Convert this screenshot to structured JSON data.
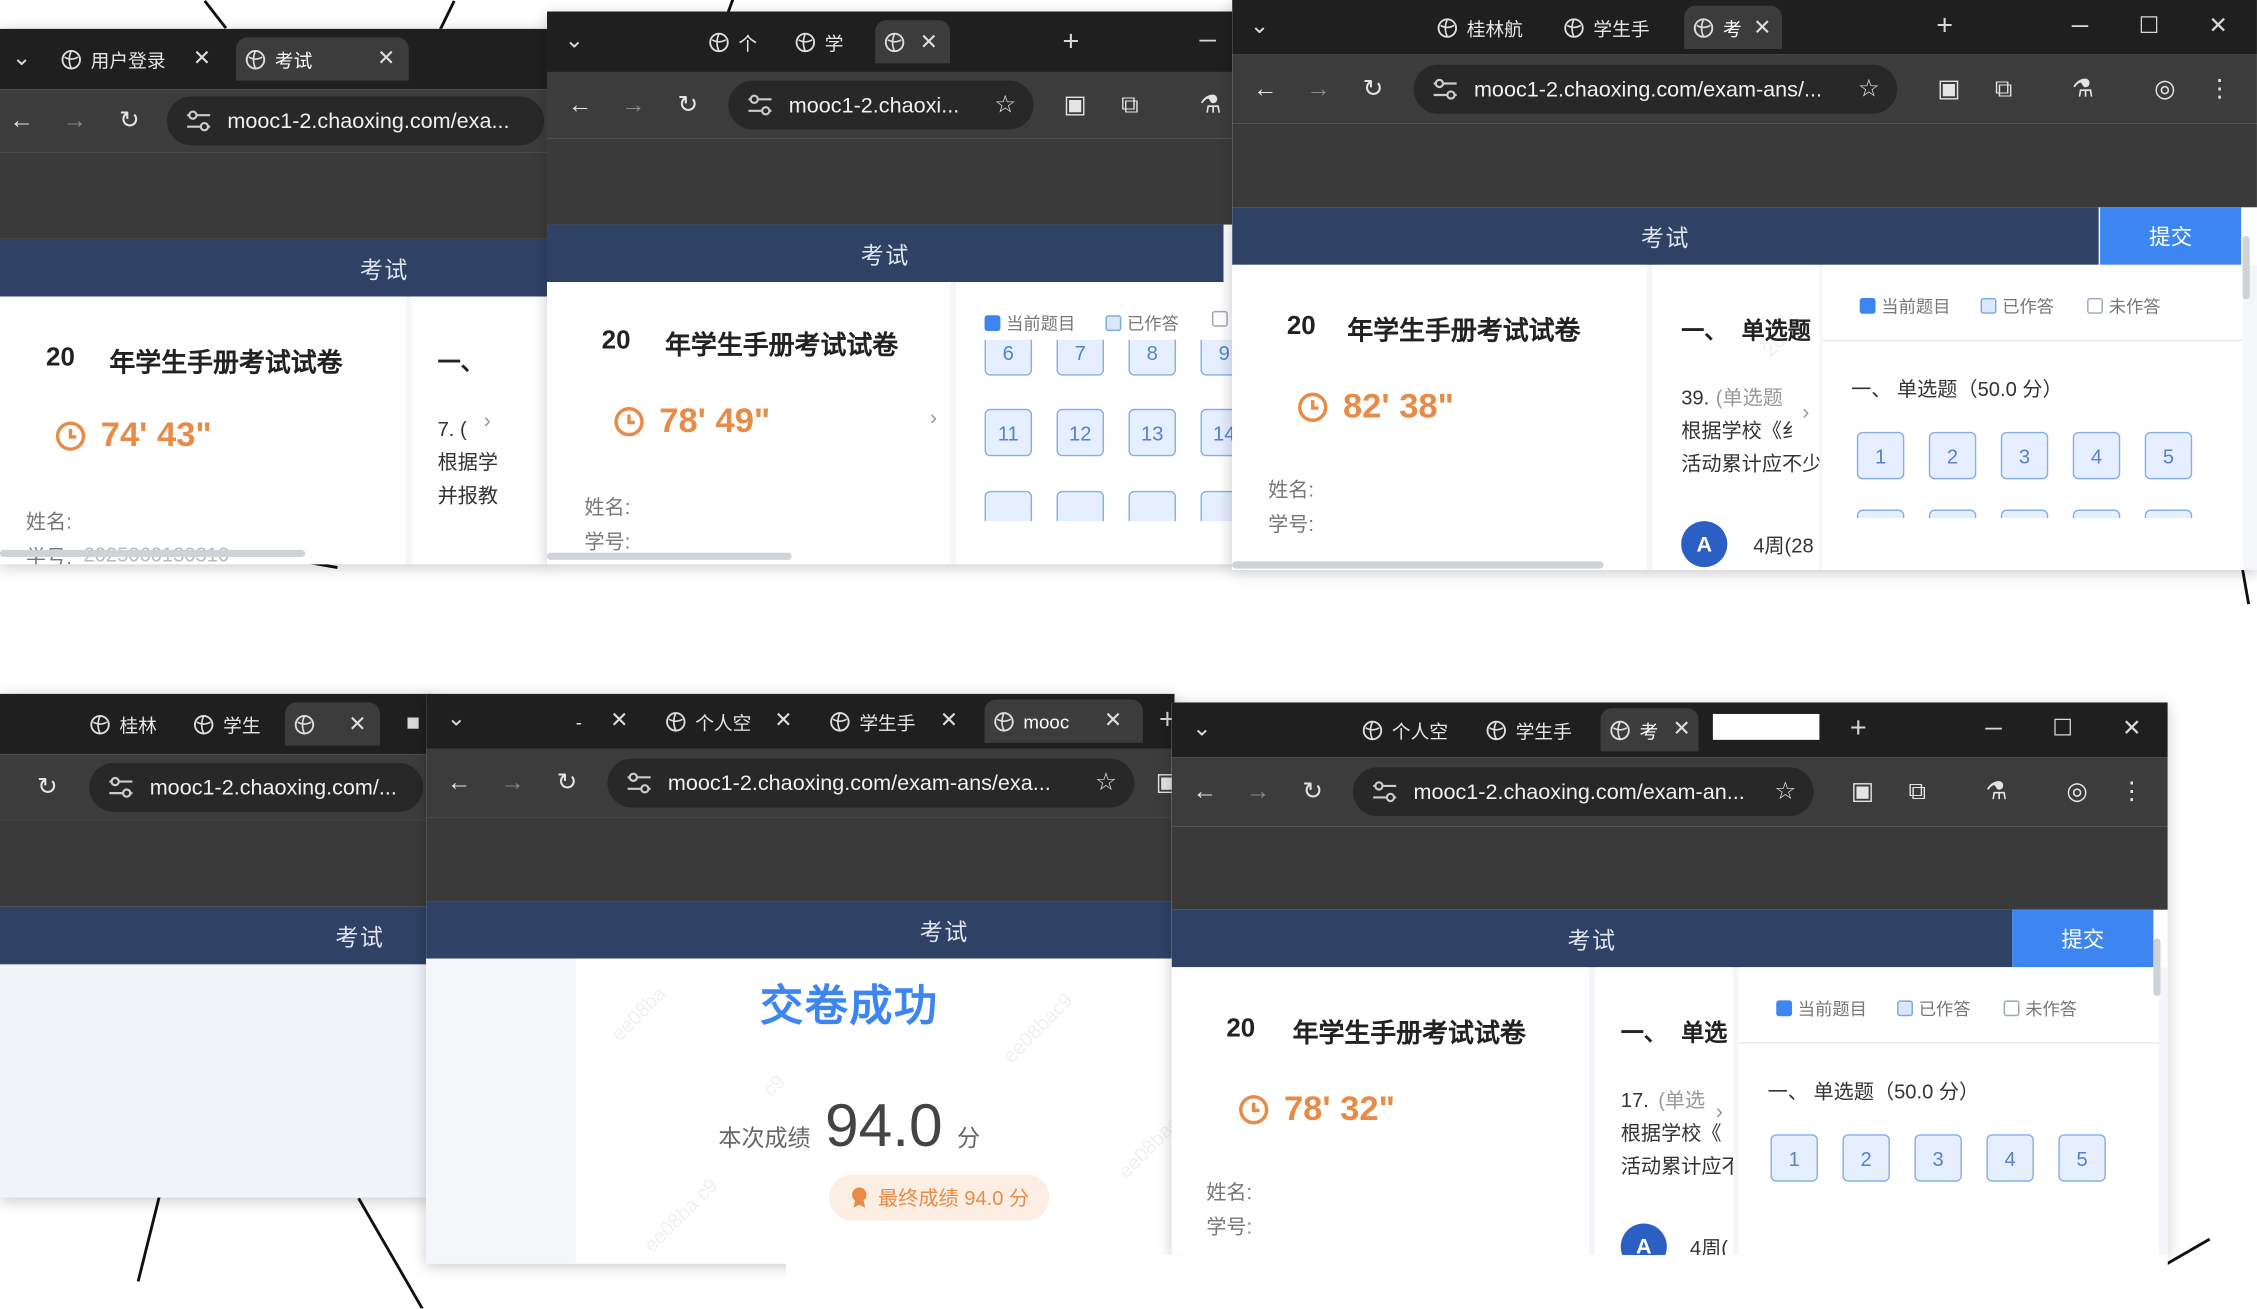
{
  "page_header": "考试",
  "exam_title": "年学生手册考试试卷",
  "exam_year_prefix": "20",
  "exam_year_partial": "20",
  "name_label": "姓名:",
  "student_id_label": "学号:",
  "url_truncated_1": "mooc1-2.chaoxing.com/exa...",
  "url_truncated_2": "mooc1-2.chaoxi...",
  "url_truncated_3": "mooc1-2.chaoxing.com/exam-ans/...",
  "url_truncated_4": "mooc1-2.chaoxing.com/...",
  "url_truncated_5": "mooc1-2.chaoxing.com/exam-ans/exa...",
  "url_truncated_6": "mooc1-2.chaoxing.com/exam-an...",
  "submit_label": "提交",
  "legend": {
    "current": "当前题目",
    "answered": "已作答",
    "unanswered": "未作答"
  },
  "section_label": "一、",
  "section_single": "单选题",
  "section_single_trunc": "单选",
  "section_with_score": "一、 单选题（50.0 分）",
  "tabs": {
    "w1": [
      "用户登录",
      "考试"
    ],
    "w2": [
      "个",
      "学"
    ],
    "w3": [
      "桂林航",
      "学生手",
      "考"
    ],
    "w4": [
      "桂林",
      "学生"
    ],
    "w5": [
      "-",
      "个人空",
      "学生手",
      "mooc"
    ],
    "w6": [
      "个人空",
      "学生手",
      "考"
    ]
  },
  "timers": {
    "w1": "74' 43\"",
    "w2": "78' 49\"",
    "w3": "82' 38\"",
    "w6": "78' 32\""
  },
  "grid_numbers": [
    "1",
    "2",
    "3",
    "4",
    "5"
  ],
  "grid_numbers_w2_top": [
    "6",
    "7",
    "8",
    "9"
  ],
  "grid_numbers_w2_mid": [
    "11",
    "12",
    "13",
    "14"
  ],
  "question_w1": {
    "number": "7. (",
    "line1": "根据学",
    "line2": "并报教"
  },
  "question_w3": {
    "number": "39.",
    "type": "(单选题",
    "line1": "根据学校《纟",
    "line2": "活动累计应不少"
  },
  "question_w6": {
    "number": "17.",
    "type": "(单选",
    "line1": "根据学校《",
    "line2": "活动累计应不"
  },
  "avatar_letter": "A",
  "avatar_text_w3": "4周(28",
  "avatar_text_w6": "4周(",
  "student_id_partial": "2025060130310",
  "success": {
    "title": "交卷成功",
    "score_label": "本次成绩",
    "score": "94.0",
    "unit": "分",
    "final": "最终成绩 94.0 分"
  },
  "watermarks": [
    "2025",
    "ee08ba",
    "c9",
    "ee08ba c9",
    "ee08bac9",
    "ee08bac3"
  ],
  "colors": {
    "header": "#2f4266",
    "accent": "#3d86f2",
    "timer": "#e88b47",
    "tabbar": "#1f1f1f",
    "toolbar": "#3c3c3c"
  }
}
